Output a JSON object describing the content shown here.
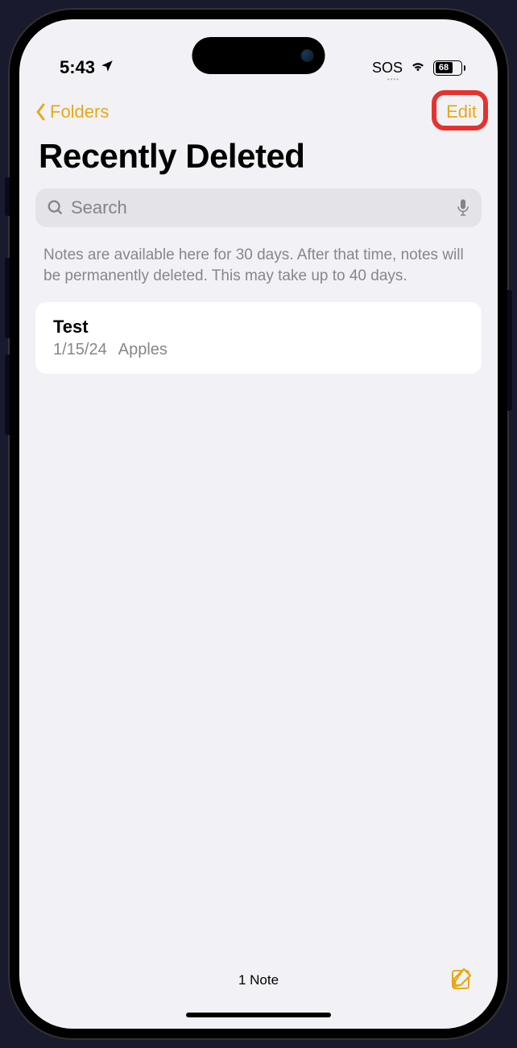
{
  "statusBar": {
    "time": "5:43",
    "sos": "SOS",
    "battery": "68"
  },
  "nav": {
    "backLabel": "Folders",
    "editLabel": "Edit"
  },
  "page": {
    "title": "Recently Deleted"
  },
  "search": {
    "placeholder": "Search"
  },
  "info": {
    "text": "Notes are available here for 30 days. After that time, notes will be permanently deleted. This may take up to 40 days."
  },
  "notes": [
    {
      "title": "Test",
      "date": "1/15/24",
      "preview": "Apples"
    }
  ],
  "footer": {
    "count": "1 Note"
  }
}
